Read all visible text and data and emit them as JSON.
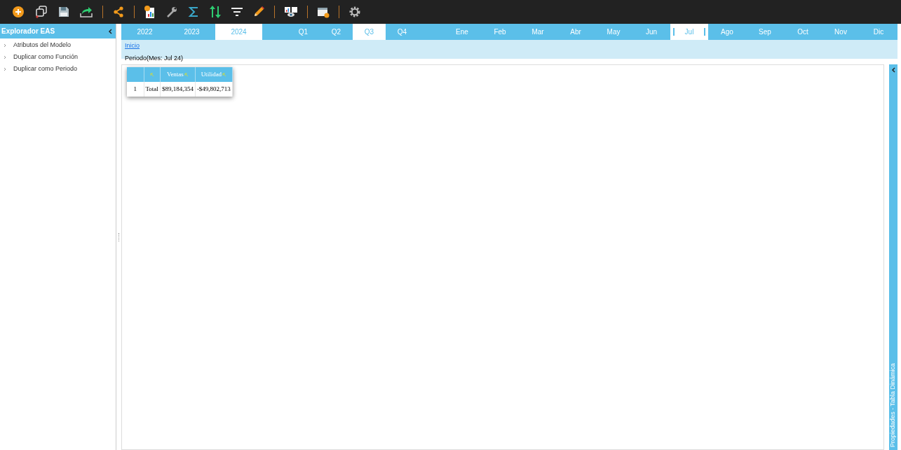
{
  "sidebar": {
    "title": "Explorador EAS",
    "items": [
      {
        "label": "Atributos del Modelo"
      },
      {
        "label": "Duplicar como Función"
      },
      {
        "label": "Duplicar como Periodo"
      }
    ]
  },
  "periods": {
    "years": [
      {
        "label": "2022",
        "selected": false
      },
      {
        "label": "2023",
        "selected": false
      },
      {
        "label": "2024",
        "selected": true
      }
    ],
    "quarters": [
      {
        "label": "Q1",
        "selected": false
      },
      {
        "label": "Q2",
        "selected": false
      },
      {
        "label": "Q3",
        "selected": true
      },
      {
        "label": "Q4",
        "selected": false
      }
    ],
    "months": [
      {
        "label": "Ene",
        "selected": false
      },
      {
        "label": "Feb",
        "selected": false
      },
      {
        "label": "Mar",
        "selected": false
      },
      {
        "label": "Abr",
        "selected": false
      },
      {
        "label": "May",
        "selected": false
      },
      {
        "label": "Jun",
        "selected": false
      },
      {
        "label": "Jul",
        "selected": true
      },
      {
        "label": "Ago",
        "selected": false
      },
      {
        "label": "Sep",
        "selected": false
      },
      {
        "label": "Oct",
        "selected": false
      },
      {
        "label": "Nov",
        "selected": false
      },
      {
        "label": "Dic",
        "selected": false
      }
    ]
  },
  "breadcrumb": {
    "link": "Inicio",
    "context": "Periodo(Mes: Jul 24)"
  },
  "pivot": {
    "columns": [
      "Ventas",
      "Utilidad"
    ],
    "rows": [
      {
        "index": "1",
        "label": "Total",
        "cells": [
          "$89,184,354",
          "-$49,802,713"
        ]
      }
    ]
  },
  "right_panel": {
    "title": "Propiedades - Tabla Dinámica"
  }
}
